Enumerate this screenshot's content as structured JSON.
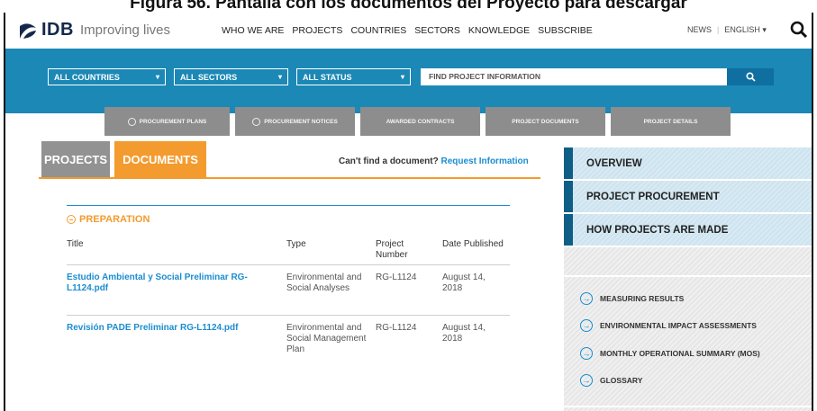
{
  "caption": "Figura 56. Pantalla con los documentos del Proyecto para descargar",
  "header": {
    "logo_text": "IDB",
    "tagline": "Improving lives",
    "nav": [
      "WHO WE ARE",
      "PROJECTS",
      "COUNTRIES",
      "SECTORS",
      "KNOWLEDGE",
      "SUBSCRIBE"
    ],
    "news": "NEWS",
    "language": "ENGLISH ▾"
  },
  "filters": {
    "countries": "ALL COUNTRIES",
    "sectors": "ALL SECTORS",
    "status": "ALL STATUS",
    "search_placeholder": "FIND PROJECT INFORMATION"
  },
  "grey_tabs": [
    "PROCUREMENT PLANS",
    "PROCUREMENT NOTICES",
    "AWARDED CONTRACTS",
    "PROJECT DOCUMENTS",
    "PROJECT DETAILS"
  ],
  "page_tabs": {
    "projects": "PROJECTS",
    "documents": "DOCUMENTS"
  },
  "cant_find": {
    "text": "Can't find a document?",
    "link": "Request Information"
  },
  "section": "PREPARATION",
  "table": {
    "headers": [
      "Title",
      "Type",
      "Project Number",
      "Date Published"
    ],
    "rows": [
      {
        "title": "Estudio Ambiental y Social Preliminar RG-L1124.pdf",
        "type": "Environmental and Social Analyses",
        "number": "RG-L1124",
        "date": "August 14, 2018"
      },
      {
        "title": "Revisión PADE Preliminar RG-L1124.pdf",
        "type": "Environmental and Social Management Plan",
        "number": "RG-L1124",
        "date": "August 14, 2018"
      }
    ]
  },
  "sidebar": {
    "items": [
      "OVERVIEW",
      "PROJECT PROCUREMENT",
      "HOW PROJECTS ARE MADE"
    ],
    "resources": [
      "MEASURING RESULTS",
      "ENVIRONMENTAL IMPACT ASSESSMENTS",
      "MONTHLY OPERATIONAL SUMMARY (MOS)",
      "GLOSSARY"
    ]
  },
  "colors": {
    "band": "#1b88b6",
    "orange": "#f39b2e",
    "link": "#1b8dd0",
    "sidebar_accent": "#0f5e86"
  }
}
